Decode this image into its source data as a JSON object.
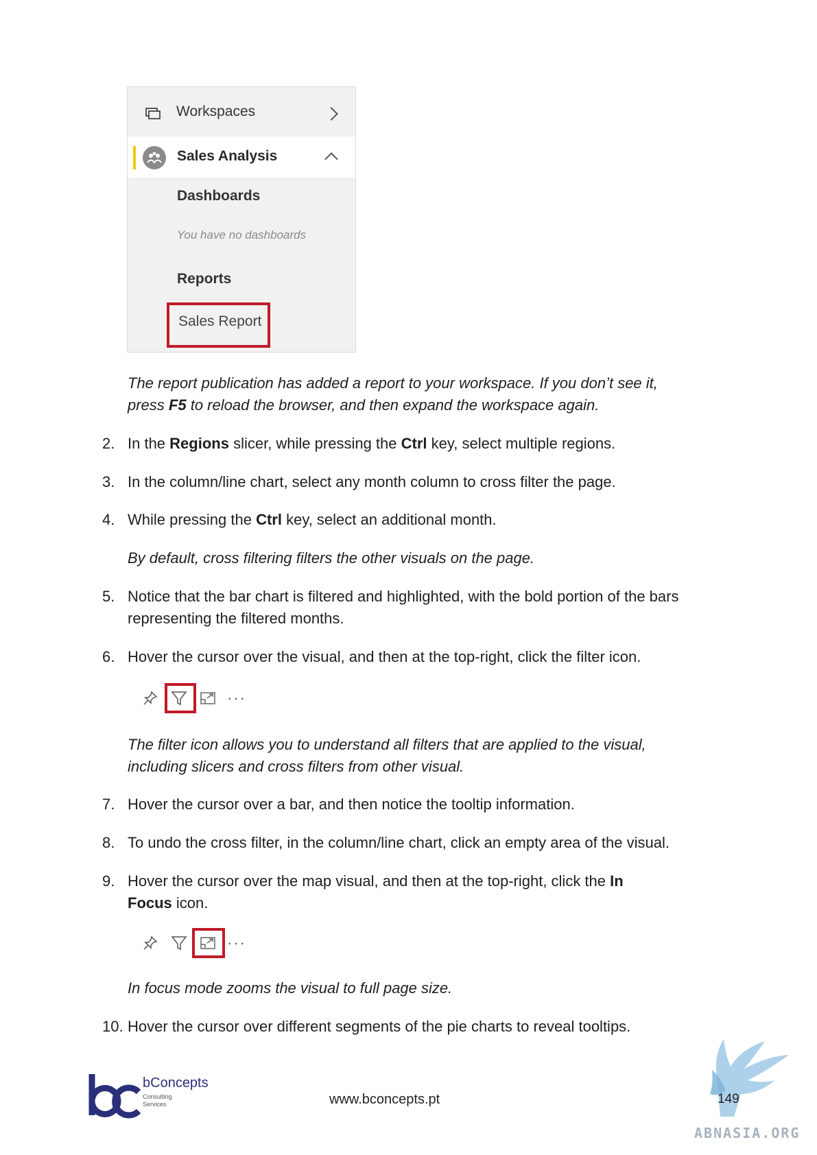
{
  "nav": {
    "workspaces": "Workspaces",
    "workspace_name": "Sales Analysis",
    "dashboards_header": "Dashboards",
    "dashboards_empty": "You have no dashboards",
    "reports_header": "Reports",
    "report_item": "Sales Report",
    "accent_color": "#f2c811",
    "highlight_color": "#c01a2a"
  },
  "note1": {
    "line1": "The report publication has added a report to your workspace. If you don’t see it,",
    "line2_a": "press ",
    "line2_key": "F5",
    "line2_b": " to reload the browser, and then expand the workspace again."
  },
  "steps": {
    "s2": {
      "num": "2.",
      "a": "In the ",
      "b1": "Regions",
      "c": " slicer, while pressing the ",
      "b2": "Ctrl",
      "d": " key, select multiple regions."
    },
    "s3": {
      "num": "3.",
      "text": "In the column/line chart, select any month column to cross filter the page."
    },
    "s4": {
      "num": "4.",
      "a": "While pressing the ",
      "b1": "Ctrl",
      "c": " key, select an additional month."
    },
    "note4": "By default, cross filtering filters the other visuals on the page.",
    "s5": {
      "num": "5.",
      "line1": "Notice that the bar chart is filtered and highlighted, with the bold portion of the bars",
      "line2": "representing the filtered months."
    },
    "s6": {
      "num": "6.",
      "text": "Hover the cursor over the visual, and then at the top-right, click the filter icon."
    },
    "note6": {
      "line1": "The filter icon allows you to understand all filters that are applied to the visual,",
      "line2": "including slicers and cross filters from other visual."
    },
    "s7": {
      "num": "7.",
      "text": "Hover the cursor over a bar, and then notice the tooltip information."
    },
    "s8": {
      "num": "8.",
      "text": "To undo the cross filter, in the column/line chart, click an empty area of the visual."
    },
    "s9": {
      "num": "9.",
      "a": "Hover the cursor over the map visual, and then at the top-right, click the ",
      "b1": "In",
      "b2": "Focus",
      "c": " icon."
    },
    "note9": "In focus mode zooms the visual to full page size.",
    "s10": {
      "num": "10.",
      "text": "Hover the cursor over different segments of the pie charts to reveal tooltips."
    }
  },
  "toolbar": {
    "icons": [
      "pin-icon",
      "filter-icon",
      "focus-mode-icon",
      "more-options-icon"
    ],
    "more": "···"
  },
  "footer": {
    "url": "www.bconcepts.pt",
    "page": "149",
    "brand": "bConcepts",
    "brand_sub1": "Consulting",
    "brand_sub2": "Services",
    "watermark": "ABNASIA.ORG"
  }
}
